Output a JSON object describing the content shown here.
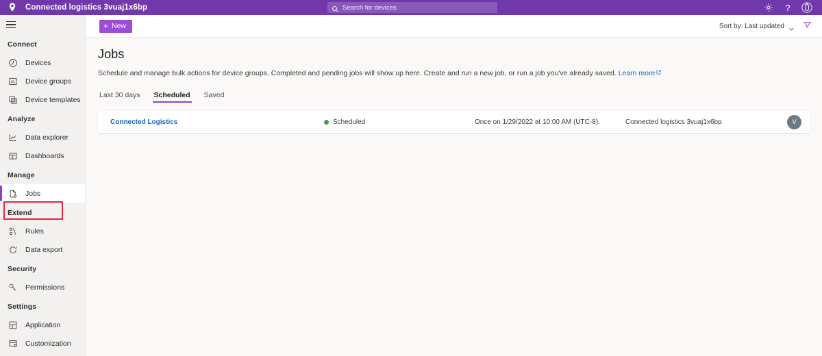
{
  "topbar": {
    "pin_icon": "location-pin-icon",
    "brand": "Connected logistics 3vuaj1x6bp",
    "search": {
      "icon": "search-icon",
      "placeholder": "Search for devices",
      "value": ""
    },
    "actions": [
      {
        "name": "settings-gear-icon",
        "label": ""
      },
      {
        "name": "help-icon",
        "label": "?"
      },
      {
        "name": "account-avatar-icon",
        "label": ""
      }
    ],
    "bar_color": "#7138ac"
  },
  "sidebar": {
    "menu_icon": "hamburger-menu-icon",
    "sections": [
      {
        "title": "Connect",
        "items": [
          {
            "label": "Devices",
            "icon": "devices-icon",
            "selected": false
          },
          {
            "label": "Device groups",
            "icon": "device-groups-icon",
            "selected": false
          },
          {
            "label": "Device templates",
            "icon": "device-templates-icon",
            "selected": false
          }
        ]
      },
      {
        "title": "Analyze",
        "items": [
          {
            "label": "Data explorer",
            "icon": "data-explorer-icon",
            "selected": false
          },
          {
            "label": "Dashboards",
            "icon": "dashboards-icon",
            "selected": false
          }
        ]
      },
      {
        "title": "Manage",
        "items": [
          {
            "label": "Jobs",
            "icon": "jobs-icon",
            "selected": true
          }
        ]
      },
      {
        "title": "Extend",
        "items": [
          {
            "label": "Rules",
            "icon": "rules-icon",
            "selected": false
          },
          {
            "label": "Data export",
            "icon": "data-export-icon",
            "selected": false
          }
        ]
      },
      {
        "title": "Security",
        "items": [
          {
            "label": "Permissions",
            "icon": "key-icon",
            "selected": false
          }
        ]
      },
      {
        "title": "Settings",
        "items": [
          {
            "label": "Application",
            "icon": "application-icon",
            "selected": false
          },
          {
            "label": "Customization",
            "icon": "customization-icon",
            "selected": false
          }
        ]
      }
    ],
    "highlight_color": "#e8243f",
    "accent_color": "#8a43c8"
  },
  "commandbar": {
    "new_button": {
      "label": "New",
      "icon": "plus-icon",
      "color": "#9b4dd8"
    },
    "sort": {
      "label": "Sort by: Last updated",
      "icon": "chevron-down-icon"
    },
    "filter": {
      "icon": "filter-funnel-icon",
      "color": "#8a43c8"
    }
  },
  "main": {
    "title": "Jobs",
    "description": "Schedule and manage bulk actions for device groups. Completed and pending jobs will show up here. Create and run a new job, or run a job you've already saved.",
    "learn_more": "Learn more",
    "learn_more_icon": "external-link-icon",
    "tabs": [
      {
        "label": "Last 30 days",
        "active": false
      },
      {
        "label": "Scheduled",
        "active": true
      },
      {
        "label": "Saved",
        "active": false
      }
    ],
    "jobs": [
      {
        "name": "Connected Logistics",
        "status": "Scheduled",
        "status_color": "#43a047",
        "schedule": "Once on 1/29/2022 at 10:00 AM (UTC-8).",
        "target": "Connected logistics 3vuaj1x6bp",
        "owner_initial": "V"
      }
    ]
  }
}
